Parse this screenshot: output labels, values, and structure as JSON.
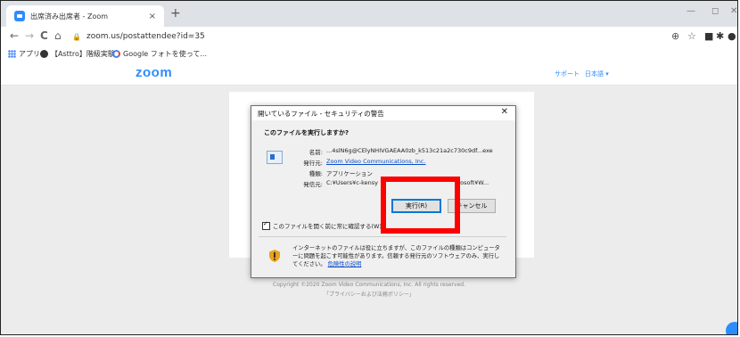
{
  "browser": {
    "tab_title": "出席済み出席者 - Zoom",
    "tab_close": "×",
    "new_tab": "+",
    "window_controls": {
      "minimize": "—",
      "restore": "◻",
      "close": "✕"
    },
    "nav": {
      "back": "←",
      "forward": "→",
      "reload": "C",
      "home": "⌂"
    },
    "lock_icon": "🔒",
    "url": "zoom.us/postattendee?id=35",
    "toolbar_icons": {
      "zoom": "⊕",
      "star": "☆",
      "extension1": "■",
      "extension2": "✱",
      "profile": "●",
      "menu": "⋮"
    },
    "bookmarks": [
      {
        "label": "アプリ",
        "icon": "apps-grid-icon"
      },
      {
        "label": "【Asttro】階級実験",
        "icon": "globe-icon"
      },
      {
        "label": "Google フォトを使って...",
        "icon": "google-icon"
      }
    ]
  },
  "zoom_page": {
    "logo": "zoom",
    "nav": {
      "support": "サポート",
      "language": "日本語 ▾"
    },
    "copyright": "Copyright ©2020 Zoom Video Communications, Inc. All rights reserved.",
    "policy": "「プライバシーおよび法務ポリシー」"
  },
  "dialog": {
    "title": "開いているファイル - セキュリティの警告",
    "close": "✕",
    "question": "このファイルを実行しますか?",
    "fields": [
      {
        "label": "名前:",
        "value": "...4slN6g@CElyNHIVGAEAA0zb_k513c21a2c730c9df...exe",
        "link": false
      },
      {
        "label": "発行元:",
        "value": "Zoom Video Communications, Inc.",
        "link": true
      },
      {
        "label": "種類:",
        "value": "アプリケーション",
        "link": false
      },
      {
        "label": "発信元:",
        "value": "C:¥Users¥c-kensy",
        "value_tail": "crosoft¥W...",
        "link": false
      }
    ],
    "run_button": "実行(R)",
    "cancel_button": "キャンセル",
    "checkbox_label": "このファイルを開く前に常に確認する(W)",
    "checkbox_checked": true,
    "warning_text": "インターネットのファイルは役に立ちますが、このファイルの種類はコンピューターに問題を起こす可能性があります。信頼する発行元のソフトウェアのみ、実行してください。",
    "warning_link": "危険性の説明"
  },
  "colors": {
    "zoom_blue": "#2d8cff",
    "highlight_red": "#ff0000",
    "link_blue": "#0b4dcb"
  }
}
